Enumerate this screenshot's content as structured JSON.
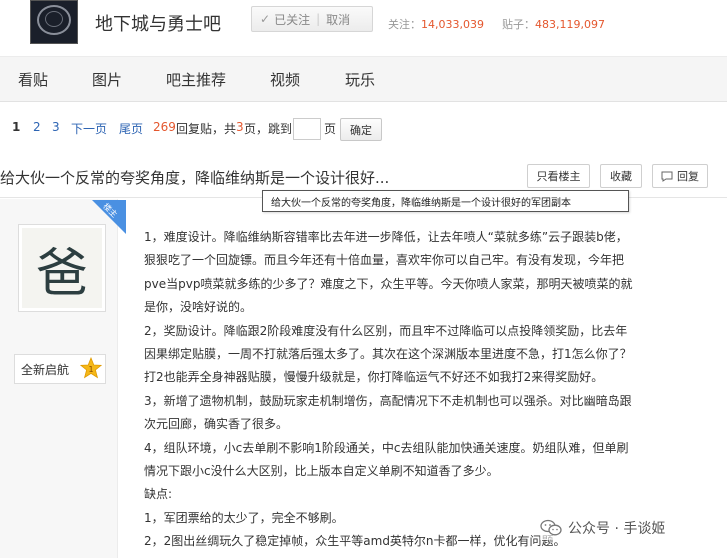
{
  "forum": {
    "name": "地下城与勇士吧",
    "follow_label": "已关注",
    "unfollow_label": "取消",
    "follow_check": "✓",
    "followers_label": "关注：",
    "followers_count": "14,033,039",
    "posts_label": "贴子：",
    "posts_count": "483,119,097"
  },
  "nav": {
    "items": [
      "看贴",
      "图片",
      "吧主推荐",
      "视频",
      "玩乐"
    ]
  },
  "pager": {
    "page1": "1",
    "page2": "2",
    "page3": "3",
    "next": "下一页",
    "last": "尾页",
    "reply_count": "269",
    "reply_suffix": "回复贴，共",
    "total_pages": "3",
    "pages_suffix": "页，跳到",
    "page_unit": "页",
    "confirm": "确定"
  },
  "post": {
    "title": "给大伙一个反常的夸奖角度，降临维纳斯是一个设计很好...",
    "tooltip": "给大伙一个反常的夸奖角度，降临维纳斯是一个设计很好的军团副本",
    "only_owner": "只看楼主",
    "collect": "收藏",
    "reply": "回复",
    "louzhu_badge": "楼主",
    "avatar_char": "爸",
    "username": "全新启航",
    "level": "1",
    "lines": [
      "1，难度设计。降临维纳斯容错率比去年进一步降低，让去年喷人“菜就多练”云子跟装b佬，",
      "狠狠吃了一个回旋镖。而且今年还有十倍血量，喜欢牢你可以自己牢。有没有发现，今年把",
      "pve当pvp喷菜就多练的少多了？难度之下，众生平等。今天你喷人家菜，那明天被喷菜的就",
      "是你，没啥好说的。",
      "2，奖励设计。降临跟2阶段难度没有什么区别，而且牢不过降临可以点投降领奖励，比去年",
      "因果绑定贴膜，一周不打就落后强太多了。其次在这个深渊版本里进度不急，打1怎么你了？",
      "打2也能弄全身神器贴膜，慢慢升级就是，你打降临运气不好还不如我打2来得奖励好。",
      "3，新增了遗物机制，鼓励玩家走机制增伤，高配情况下不走机制也可以强杀。对比幽暗岛跟",
      "次元回廊，确实香了很多。",
      "4，组队环境，小c去单刷不影响1阶段通关，中c去组队能加快通关速度。奶组队难，但单刷",
      "情况下跟小c没什么大区别，比上版本自定义单刷不知道香了多少。",
      "缺点:",
      "1，军团票给的太少了，完全不够刷。",
      "2，2图出丝绸玩久了稳定掉帧，众生平等amd英特尔n卡都一样，优化有问题。"
    ]
  },
  "watermark": {
    "text": "公众号 · 手谈姬"
  },
  "colors": {
    "link": "#2d64b3",
    "highlight": "#e4572e",
    "badge": "#4a90e2",
    "nav_bg": "#f5f5f5"
  }
}
